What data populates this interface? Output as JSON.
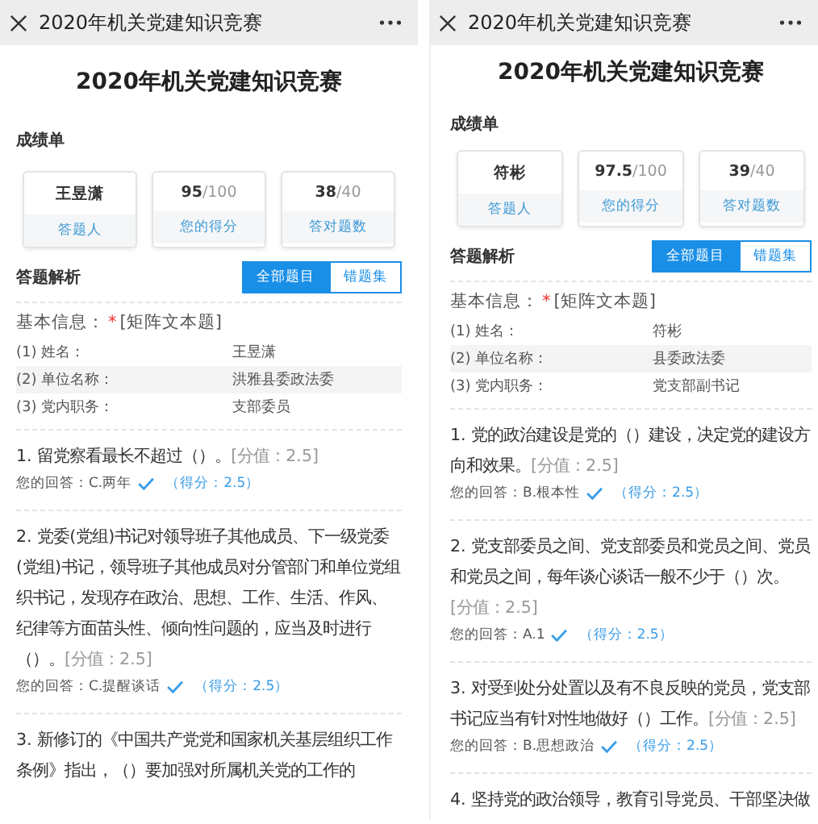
{
  "phones": [
    {
      "title_bar": {
        "title": "2020年机关党建知识竞赛"
      },
      "page_title": "2020年机关党建知识竞赛",
      "scorecard": {
        "heading": "成绩单",
        "cards": [
          {
            "value": "王昱潇",
            "label": "答题人"
          },
          {
            "value": "95",
            "total": "/100",
            "label": "您的得分"
          },
          {
            "value": "38",
            "total": "/40",
            "label": "答对题数"
          }
        ]
      },
      "analysis": {
        "heading": "答题解析",
        "tabs": [
          {
            "label": "全部题目",
            "selected": true
          },
          {
            "label": "错题集",
            "selected": false
          }
        ]
      },
      "basic_info": {
        "label": "基本信息：",
        "required_mark": "*",
        "type": "[矩阵文本题]",
        "rows": [
          {
            "field": "(1) 姓名：",
            "value": "王昱潇"
          },
          {
            "field": "(2) 单位名称：",
            "value": "洪雅县委政法委"
          },
          {
            "field": "(3) 党内职务：",
            "value": "支部委员"
          }
        ]
      },
      "questions": [
        {
          "text": "1. 留党察看最长不超过（）。",
          "value": "[分值：2.5]",
          "answer_label": "您的回答：",
          "answer": "C.两年",
          "correct": true,
          "points": "（得分：2.5）"
        },
        {
          "text": "2. 党委(党组)书记对领导班子其他成员、下一级党委(党组)书记，领导班子其他成员对分管部门和单位党组织书记，发现存在政治、思想、工作、生活、作风、纪律等方面苗头性、倾向性问题的，应当及时进行（）。",
          "value": "[分值：2.5]",
          "answer_label": "您的回答：",
          "answer": "C.提醒谈话",
          "correct": true,
          "points": "（得分：2.5）"
        },
        {
          "text": "3. 新修订的《中国共产党党和国家机关基层组织工作条例》指出，（）要加强对所属机关党的工作的"
        }
      ]
    },
    {
      "title_bar": {
        "title": "2020年机关党建知识竞赛"
      },
      "page_title": "2020年机关党建知识竞赛",
      "scorecard": {
        "heading": "成绩单",
        "cards": [
          {
            "value": "符彬",
            "label": "答题人"
          },
          {
            "value": "97.5",
            "total": "/100",
            "label": "您的得分"
          },
          {
            "value": "39",
            "total": "/40",
            "label": "答对题数"
          }
        ]
      },
      "analysis": {
        "heading": "答题解析",
        "tabs": [
          {
            "label": "全部题目",
            "selected": true
          },
          {
            "label": "错题集",
            "selected": false
          }
        ]
      },
      "basic_info": {
        "label": "基本信息：",
        "required_mark": "*",
        "type": "[矩阵文本题]",
        "rows": [
          {
            "field": "(1) 姓名：",
            "value": "符彬"
          },
          {
            "field": "(2) 单位名称：",
            "value": "县委政法委"
          },
          {
            "field": "(3) 党内职务：",
            "value": "党支部副书记"
          }
        ]
      },
      "questions": [
        {
          "text": "1. 党的政治建设是党的（）建设，决定党的建设方向和效果。",
          "value": "[分值：2.5]",
          "answer_label": "您的回答：",
          "answer": "B.根本性",
          "correct": true,
          "points": "（得分：2.5）"
        },
        {
          "text": "2. 党支部委员之间、党支部委员和党员之间、党员和党员之间，每年谈心谈话一般不少于（）次。",
          "value": "[分值：2.5]",
          "answer_label": "您的回答：",
          "answer": "A.1",
          "correct": true,
          "points": "（得分：2.5）"
        },
        {
          "text": "3. 对受到处分处置以及有不良反映的党员，党支部书记应当有针对性地做好（）工作。",
          "value": "[分值：2.5]",
          "answer_label": "您的回答：",
          "answer": "B.思想政治",
          "correct": true,
          "points": "（得分：2.5）"
        },
        {
          "text": "4. 坚持党的政治领导，教育引导党员、干部坚决做"
        }
      ]
    }
  ]
}
